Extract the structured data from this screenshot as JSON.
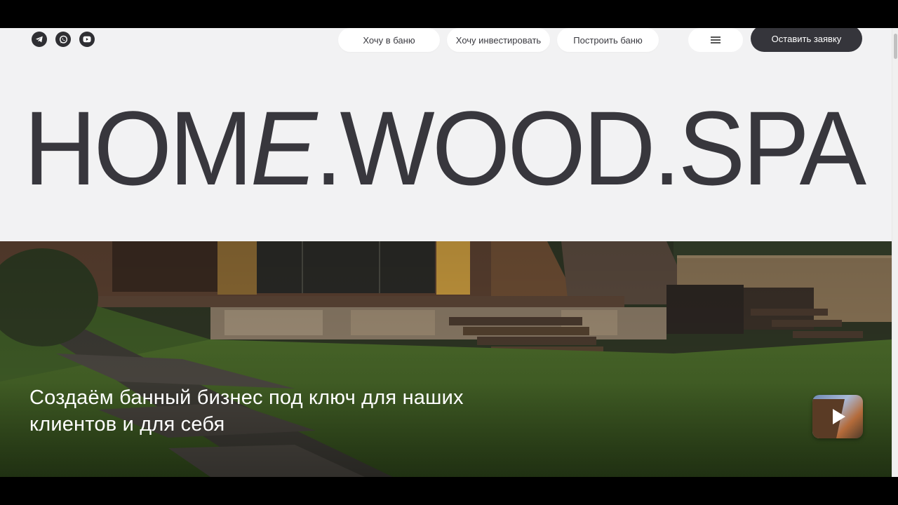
{
  "header": {
    "social": [
      {
        "icon": "telegram-icon"
      },
      {
        "icon": "whatsapp-icon"
      },
      {
        "icon": "youtube-icon"
      }
    ],
    "nav": [
      {
        "label": "Хочу в баню"
      },
      {
        "label": "Хочу инвестировать"
      },
      {
        "label": "Построить баню"
      }
    ],
    "menu_icon": "hamburger-icon",
    "cta_label": "Оставить заявку"
  },
  "logo": {
    "part1": "HOM",
    "part2": "E",
    "part3": ".",
    "part4": "WOOD",
    "part5": ".",
    "part6": "SPA"
  },
  "hero": {
    "title": "Создаём банный бизнес под ключ для наших клиентов и для себя",
    "video_icon": "play-icon"
  },
  "colors": {
    "background": "#f2f2f3",
    "text_dark": "#38373d",
    "cta_bg": "#35353b",
    "pill_bg": "#ffffff"
  }
}
